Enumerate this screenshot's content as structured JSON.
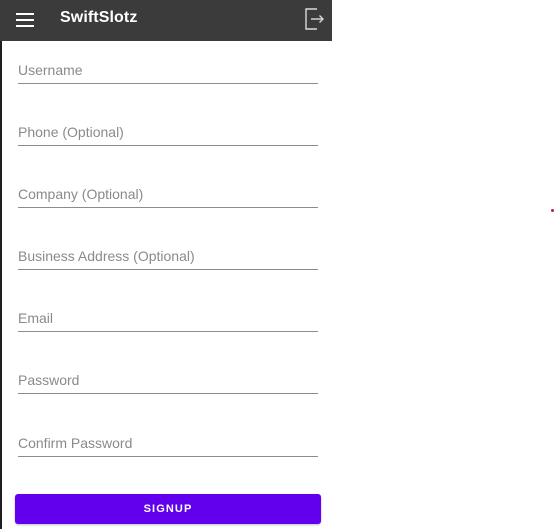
{
  "app_bar": {
    "title": "SwiftSlotz",
    "menu_icon": "hamburger-menu-icon",
    "logout_icon": "logout-icon",
    "background": "#3b3b3b"
  },
  "form": {
    "fields": [
      {
        "placeholder": "Username",
        "value": ""
      },
      {
        "placeholder": "Phone (Optional)",
        "value": ""
      },
      {
        "placeholder": "Company (Optional)",
        "value": ""
      },
      {
        "placeholder": "Business Address (Optional)",
        "value": ""
      },
      {
        "placeholder": "Email",
        "value": ""
      },
      {
        "placeholder": "Password",
        "value": ""
      },
      {
        "placeholder": "Confirm Password",
        "value": ""
      }
    ],
    "submit_label": "SIGNUP",
    "accent": "#6200ee"
  }
}
